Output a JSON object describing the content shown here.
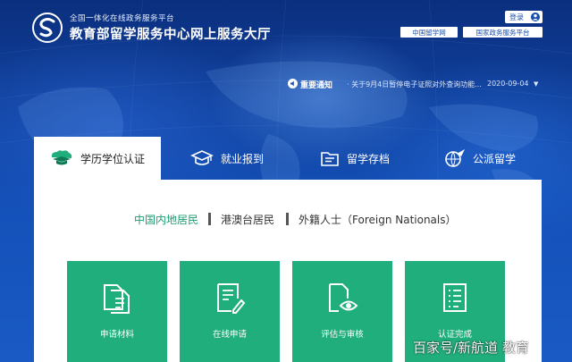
{
  "header": {
    "subtitle": "全国一体化在线政务服务平台",
    "title": "教育部留学服务中心网上服务大厅",
    "login_label": "登录",
    "links": [
      "中国留学网",
      "国家政务服务平台"
    ]
  },
  "notice": {
    "label": "重要通知",
    "text": "· 关于9月4日暂停电子证照对外查询功能...",
    "date": "2020-09-04"
  },
  "tabs": [
    {
      "label": "学历学位认证",
      "icon": "graduation-cap-icon",
      "active": true
    },
    {
      "label": "就业报到",
      "icon": "mortarboard-icon"
    },
    {
      "label": "留学存档",
      "icon": "archive-folder-icon"
    },
    {
      "label": "公派留学",
      "icon": "globe-plane-icon"
    }
  ],
  "categories": [
    {
      "label": "中国内地居民",
      "active": true
    },
    {
      "label": "港澳台居民"
    },
    {
      "label": "外籍人士（Foreign Nationals）"
    }
  ],
  "steps": [
    {
      "label": "申请材料",
      "icon": "documents-icon"
    },
    {
      "label": "在线申请",
      "icon": "form-edit-icon"
    },
    {
      "label": "评估与审核",
      "icon": "document-eye-icon"
    },
    {
      "label": "认证完成",
      "icon": "checklist-icon"
    }
  ],
  "watermark": "百家号/新航道 教育",
  "colors": {
    "brand_blue": "#1a4fb0",
    "step_green": "#1fae7c",
    "active_green": "#1e9b73"
  }
}
